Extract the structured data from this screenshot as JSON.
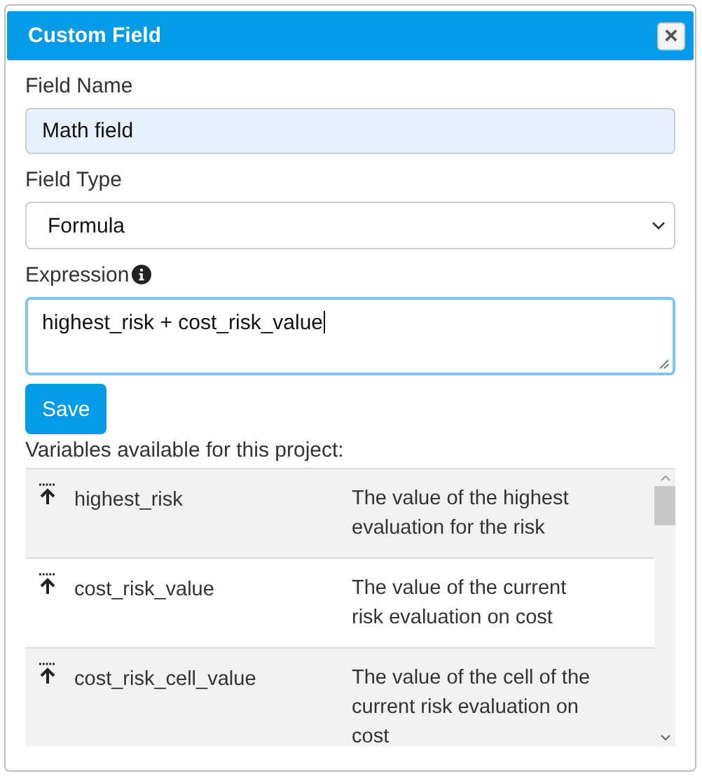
{
  "dialog": {
    "title": "Custom Field",
    "close": "×"
  },
  "fields": [
    {
      "kind": "text",
      "label": "Field Name",
      "value": "Math field"
    },
    {
      "kind": "select",
      "label": "Field Type",
      "value": "Formula"
    },
    {
      "kind": "textarea",
      "label": "Expression",
      "value": "highest_risk + cost_risk_value",
      "info": true
    }
  ],
  "save_button": "Save",
  "variables": {
    "heading": "Variables available for this project:",
    "rows": [
      {
        "name": "highest_risk",
        "description": "The value of the highest evaluation for the risk"
      },
      {
        "name": "cost_risk_value",
        "description": "The value of the current risk evaluation on cost"
      },
      {
        "name": "cost_risk_cell_value",
        "description": "The value of the cell of the current risk evaluation on cost"
      }
    ]
  }
}
